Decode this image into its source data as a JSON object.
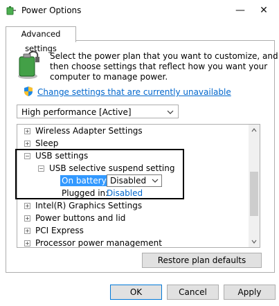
{
  "window": {
    "title": "Power Options"
  },
  "tabs": [
    {
      "label": "Advanced settings"
    }
  ],
  "description": {
    "line1": "Select the power plan that you want to customize, and",
    "line2": "then choose settings that reflect how you want your",
    "line3": "computer to manage power."
  },
  "change_link": "Change settings that are currently unavailable",
  "plan": {
    "selected": "High performance [Active]"
  },
  "tree": {
    "items": [
      {
        "label": "Wireless Adapter Settings",
        "expander": "+"
      },
      {
        "label": "Sleep",
        "expander": "+"
      },
      {
        "label": "USB settings",
        "expander": "−"
      },
      {
        "label": "USB selective suspend setting",
        "expander": "−"
      },
      {
        "label": "Intel(R) Graphics Settings",
        "expander": "+"
      },
      {
        "label": "Power buttons and lid",
        "expander": "+"
      },
      {
        "label": "PCI Express",
        "expander": "+"
      },
      {
        "label": "Processor power management",
        "expander": "+"
      }
    ],
    "on_battery": {
      "label": "On battery:",
      "value": "Disabled"
    },
    "plugged_in": {
      "label": "Plugged in:",
      "value": "Disabled"
    }
  },
  "buttons": {
    "restore": "Restore plan defaults",
    "ok": "OK",
    "cancel": "Cancel",
    "apply": "Apply"
  },
  "icons": {
    "app": "power-options-icon",
    "minimize": "minimize-icon",
    "close": "close-icon",
    "battery": "battery-plug-icon",
    "shield": "uac-shield-icon"
  },
  "colors": {
    "link": "#0066cc",
    "selection": "#3399ff"
  }
}
